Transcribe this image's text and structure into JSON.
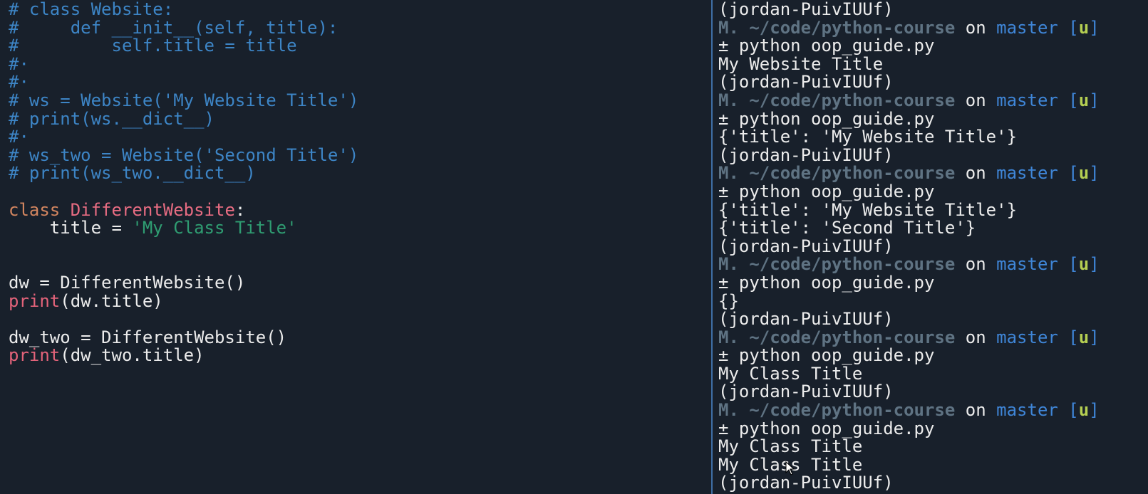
{
  "editor": {
    "lines": [
      {
        "segments": [
          {
            "cls": "comment",
            "text": "# class Website:"
          }
        ]
      },
      {
        "segments": [
          {
            "cls": "comment",
            "text": "#     def __init__(self, title):"
          }
        ]
      },
      {
        "segments": [
          {
            "cls": "comment",
            "text": "#         self.title = title"
          }
        ]
      },
      {
        "segments": [
          {
            "cls": "comment",
            "text": "#·"
          }
        ]
      },
      {
        "segments": [
          {
            "cls": "comment",
            "text": "#·"
          }
        ]
      },
      {
        "segments": [
          {
            "cls": "comment",
            "text": "# ws = Website('My Website Title')"
          }
        ]
      },
      {
        "segments": [
          {
            "cls": "comment",
            "text": "# print(ws.__dict__)"
          }
        ]
      },
      {
        "segments": [
          {
            "cls": "comment",
            "text": "#·"
          }
        ]
      },
      {
        "segments": [
          {
            "cls": "comment",
            "text": "# ws_two = Website('Second Title')"
          }
        ]
      },
      {
        "segments": [
          {
            "cls": "comment",
            "text": "# print(ws_two.__dict__)"
          }
        ]
      },
      {
        "segments": []
      },
      {
        "segments": [
          {
            "cls": "kw",
            "text": "class "
          },
          {
            "cls": "cls",
            "text": "DifferentWebsite"
          },
          {
            "cls": "txt",
            "text": ":"
          }
        ]
      },
      {
        "segments": [
          {
            "cls": "txt",
            "text": "    title = "
          },
          {
            "cls": "str",
            "text": "'My Class Title'"
          }
        ]
      },
      {
        "segments": []
      },
      {
        "segments": []
      },
      {
        "segments": [
          {
            "cls": "txt",
            "text": "dw = DifferentWebsite()"
          }
        ]
      },
      {
        "segments": [
          {
            "cls": "builtin",
            "text": "print"
          },
          {
            "cls": "txt",
            "text": "(dw.title)"
          }
        ]
      },
      {
        "segments": []
      },
      {
        "segments": [
          {
            "cls": "txt",
            "text": "dw_two = DifferentWebsite()"
          }
        ]
      },
      {
        "segments": [
          {
            "cls": "builtin",
            "text": "print"
          },
          {
            "cls": "txt",
            "text": "(dw_two.title)"
          }
        ]
      }
    ]
  },
  "terminal": {
    "prompt": {
      "cwd": "M. ~/code/python-course",
      "on": " on ",
      "branch": "master",
      "bracket_open": " [",
      "status": "u",
      "bracket_close": "]"
    },
    "lines": [
      {
        "type": "out",
        "text": "(jordan-PuivIUUf)"
      },
      {
        "type": "prompt"
      },
      {
        "type": "out",
        "text": "± python oop_guide.py"
      },
      {
        "type": "out",
        "text": "My Website Title"
      },
      {
        "type": "out",
        "text": "(jordan-PuivIUUf)"
      },
      {
        "type": "prompt"
      },
      {
        "type": "out",
        "text": "± python oop_guide.py"
      },
      {
        "type": "out",
        "text": "{'title': 'My Website Title'}"
      },
      {
        "type": "out",
        "text": "(jordan-PuivIUUf)"
      },
      {
        "type": "prompt"
      },
      {
        "type": "out",
        "text": "± python oop_guide.py"
      },
      {
        "type": "out",
        "text": "{'title': 'My Website Title'}"
      },
      {
        "type": "out",
        "text": "{'title': 'Second Title'}"
      },
      {
        "type": "out",
        "text": "(jordan-PuivIUUf)"
      },
      {
        "type": "prompt"
      },
      {
        "type": "out",
        "text": "± python oop_guide.py"
      },
      {
        "type": "out",
        "text": "{}"
      },
      {
        "type": "out",
        "text": "(jordan-PuivIUUf)"
      },
      {
        "type": "prompt"
      },
      {
        "type": "out",
        "text": "± python oop_guide.py"
      },
      {
        "type": "out",
        "text": "My Class Title"
      },
      {
        "type": "out",
        "text": "(jordan-PuivIUUf)"
      },
      {
        "type": "prompt"
      },
      {
        "type": "out",
        "text": "± python oop_guide.py"
      },
      {
        "type": "out",
        "text": "My Class Title"
      },
      {
        "type": "out",
        "text": "My Class Title"
      },
      {
        "type": "out",
        "text": "(jordan-PuivIUUf)"
      }
    ]
  },
  "colors": {
    "background": "#18202b",
    "comment": "#3d85c6",
    "keyword": "#d2855f",
    "class_name": "#e76c82",
    "string": "#2f9d72",
    "branch": "#3f86d8",
    "status": "#b5cf52"
  },
  "icons": {
    "mouse_cursor": "mouse-cursor-icon"
  }
}
